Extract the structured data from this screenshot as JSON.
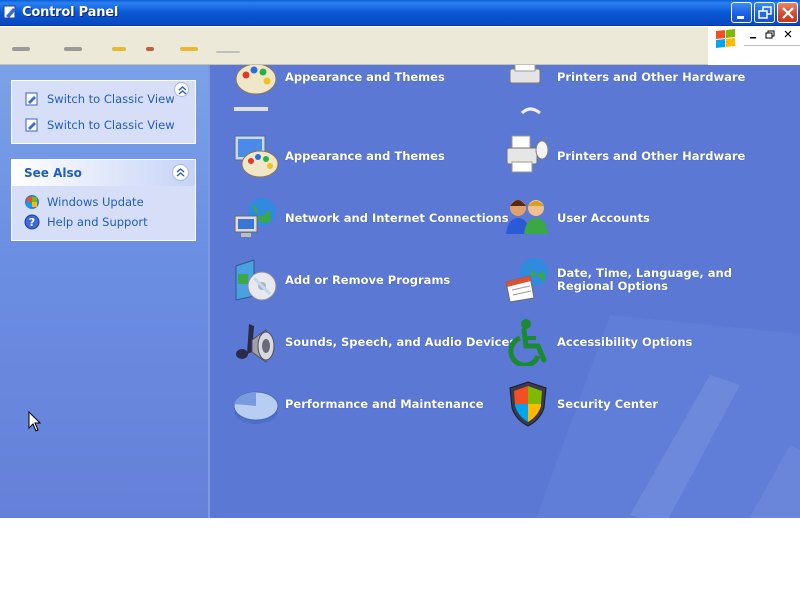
{
  "window": {
    "title": "Control Panel"
  },
  "task_pane": {
    "tasks": [
      {
        "label": "Switch to Classic View"
      },
      {
        "label": "Switch to Classic View"
      }
    ],
    "see_also": {
      "title": "See Also",
      "links": [
        {
          "label": "Windows Update",
          "icon": "windows-update-icon"
        },
        {
          "label": "Help and Support",
          "icon": "help-icon"
        }
      ]
    }
  },
  "categories": [
    {
      "label": "Appearance and Themes",
      "icon": "appearance-themes-icon"
    },
    {
      "label": "Printers and Other Hardware",
      "icon": "printers-hardware-icon"
    },
    {
      "label": "Appearance and Themes",
      "icon": "appearance-themes-icon"
    },
    {
      "label": "Printers and Other Hardware",
      "icon": "printers-hardware-icon"
    },
    {
      "label": "Network and Internet Connections",
      "icon": "network-icon"
    },
    {
      "label": "User Accounts",
      "icon": "user-accounts-icon"
    },
    {
      "label": "Add or Remove Programs",
      "icon": "add-remove-programs-icon"
    },
    {
      "label": "Date, Time, Language, and Regional Options",
      "icon": "date-time-icon"
    },
    {
      "label": "Sounds, Speech, and Audio Devices",
      "icon": "sounds-icon"
    },
    {
      "label": "Accessibility Options",
      "icon": "accessibility-icon"
    },
    {
      "label": "Performance and Maintenance",
      "icon": "performance-icon"
    },
    {
      "label": "Security Center",
      "icon": "security-center-icon"
    }
  ],
  "colors": {
    "titlebar": "#0a58d6",
    "pane_blue": "#6b8fe3",
    "main_blue": "#5a78d4",
    "link_blue": "#215dc6"
  }
}
